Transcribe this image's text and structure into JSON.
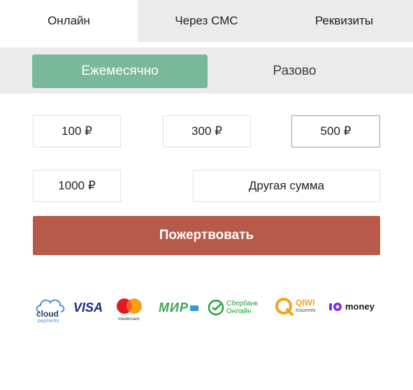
{
  "tabs": [
    {
      "label": "Онлайн",
      "active": true
    },
    {
      "label": "Через СМС",
      "active": false
    },
    {
      "label": "Реквизиты",
      "active": false
    }
  ],
  "frequency": {
    "monthly_label": "Ежемесячно",
    "once_label": "Разово",
    "selected": "monthly"
  },
  "amounts": {
    "a100": "100 ₽",
    "a300": "300 ₽",
    "a500": "500 ₽",
    "a1000": "1000 ₽",
    "other": "Другая сумма",
    "selected": "500 ₽"
  },
  "donate_label": "Пожертвовать",
  "colors": {
    "accent_green": "#79b899",
    "donate_red": "#b85a4a",
    "tab_gray": "#ebebeb"
  },
  "payment_logos": {
    "cloud": {
      "name": "cloud-payments-logo",
      "text": "cloud",
      "sub": "payments"
    },
    "visa": {
      "name": "visa-logo",
      "text": "VISA"
    },
    "mastercard": {
      "name": "mastercard-logo",
      "text": "mastercard"
    },
    "mir": {
      "name": "mir-logo",
      "text": "МИР"
    },
    "sber": {
      "name": "sberbank-online-logo",
      "line1": "Сбербанк",
      "line2": "Онлайн"
    },
    "qiwi": {
      "name": "qiwi-wallet-logo",
      "text": "QIWI",
      "sub": "Кошелек"
    },
    "yoomoney": {
      "name": "yoomoney-logo",
      "text": "money"
    }
  }
}
